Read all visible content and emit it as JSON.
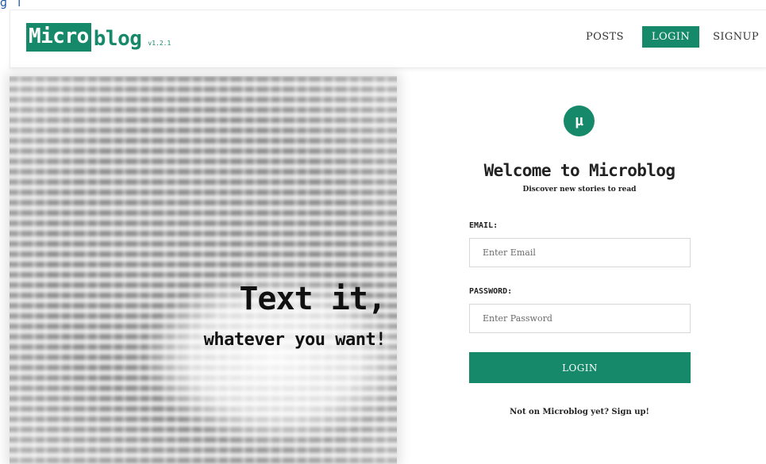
{
  "colors": {
    "accent": "#15896a"
  },
  "nav": {
    "brand_box": "Micro",
    "brand_rest": "blog",
    "brand_version": "v1.2.1",
    "links": [
      "POSTS",
      "LOGIN",
      "SIGNUP"
    ]
  },
  "hero": {
    "title": "Text it,",
    "subtitle": "whatever you want!"
  },
  "login": {
    "logo_glyph": "µ",
    "welcome": "Welcome to Microblog",
    "tagline": "Discover new stories to read",
    "email_label": "EMAIL:",
    "email_placeholder": "Enter Email",
    "password_label": "PASSWORD:",
    "password_placeholder": "Enter Password",
    "button": "LOGIN",
    "signup_note": "Not on Microblog yet? Sign up!"
  }
}
